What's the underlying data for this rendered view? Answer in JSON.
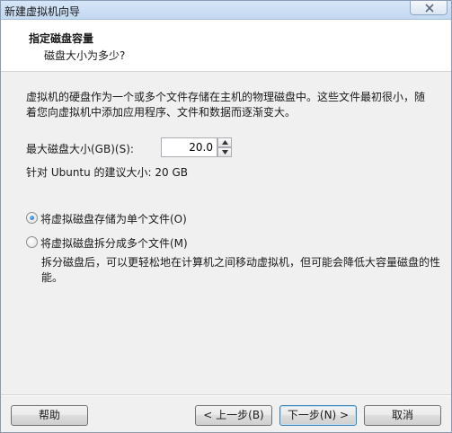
{
  "window": {
    "title": "新建虚拟机向导"
  },
  "header": {
    "title": "指定磁盘容量",
    "subtitle": "磁盘大小为多少?"
  },
  "description": "虚拟机的硬盘作为一个或多个文件存储在主机的物理磁盘中。这些文件最初很小，随着您向虚拟机中添加应用程序、文件和数据而逐渐变大。",
  "disk_size": {
    "label": "最大磁盘大小(GB)(S):",
    "value": "20.0"
  },
  "recommendation": "针对 Ubuntu 的建议大小: 20 GB",
  "options": {
    "single_file": {
      "label": "将虚拟磁盘存储为单个文件(O)",
      "selected": true
    },
    "multi_file": {
      "label": "将虚拟磁盘拆分成多个文件(M)",
      "selected": false,
      "description": "拆分磁盘后，可以更轻松地在计算机之间移动虚拟机，但可能会降低大容量磁盘的性能。"
    }
  },
  "buttons": {
    "help": "帮助",
    "back": "< 上一步(B)",
    "next": "下一步(N) >",
    "cancel": "取消"
  },
  "icons": {
    "close": "close-icon",
    "spin_up": "triangle-up-icon",
    "spin_down": "triangle-down-icon"
  }
}
